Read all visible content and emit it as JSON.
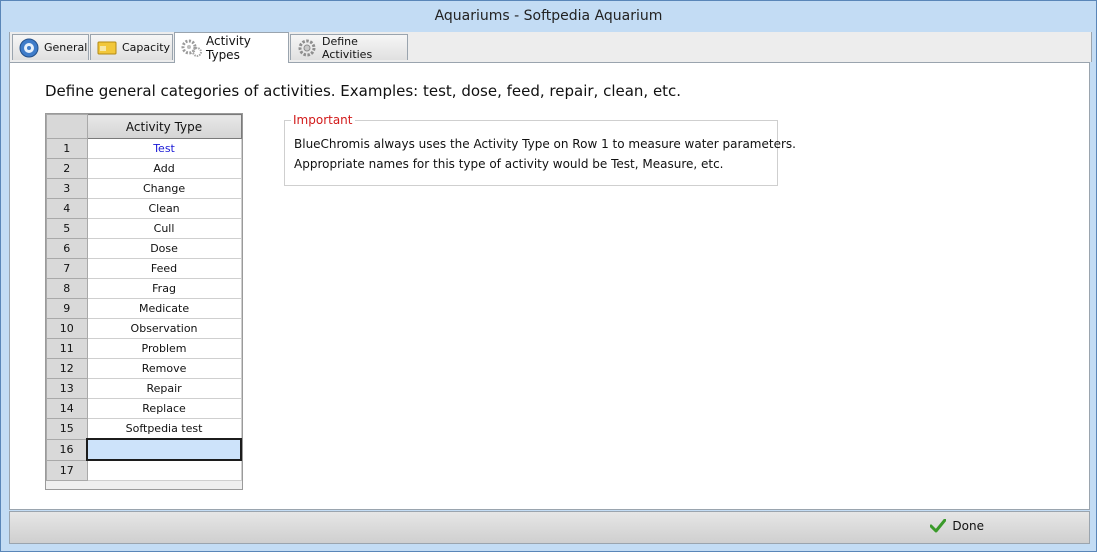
{
  "window": {
    "title": "Aquariums  -  Softpedia Aquarium"
  },
  "tabs": [
    {
      "label": "General",
      "icon": "general-icon"
    },
    {
      "label": "Capacity",
      "icon": "capacity-icon"
    },
    {
      "label": "Activity Types",
      "icon": "gears-icon",
      "active": true
    },
    {
      "label": "Define Activities",
      "icon": "gear-icon"
    }
  ],
  "main": {
    "headline": "Define general categories of activities.  Examples: test, dose, feed, repair, clean, etc."
  },
  "grid": {
    "column_header": "Activity Type",
    "rows": [
      {
        "num": "1",
        "value": "Test"
      },
      {
        "num": "2",
        "value": "Add"
      },
      {
        "num": "3",
        "value": "Change"
      },
      {
        "num": "4",
        "value": "Clean"
      },
      {
        "num": "5",
        "value": "Cull"
      },
      {
        "num": "6",
        "value": "Dose"
      },
      {
        "num": "7",
        "value": "Feed"
      },
      {
        "num": "8",
        "value": "Frag"
      },
      {
        "num": "9",
        "value": "Medicate"
      },
      {
        "num": "10",
        "value": "Observation"
      },
      {
        "num": "11",
        "value": "Problem"
      },
      {
        "num": "12",
        "value": "Remove"
      },
      {
        "num": "13",
        "value": "Repair"
      },
      {
        "num": "14",
        "value": "Replace"
      },
      {
        "num": "15",
        "value": "Softpedia test"
      },
      {
        "num": "16",
        "value": ""
      },
      {
        "num": "17",
        "value": ""
      }
    ]
  },
  "important": {
    "legend": "Important",
    "line1": "BlueChromis always uses the Activity Type on Row 1 to measure water parameters.",
    "line2": "Appropriate names for this type of activity would be Test, Measure, etc."
  },
  "footer": {
    "done_label": "Done"
  },
  "colors": {
    "accent": "#c3dcf4",
    "important": "#d21a1a",
    "first_row_text": "#1a1ad6",
    "selection": "#cde3fa"
  }
}
